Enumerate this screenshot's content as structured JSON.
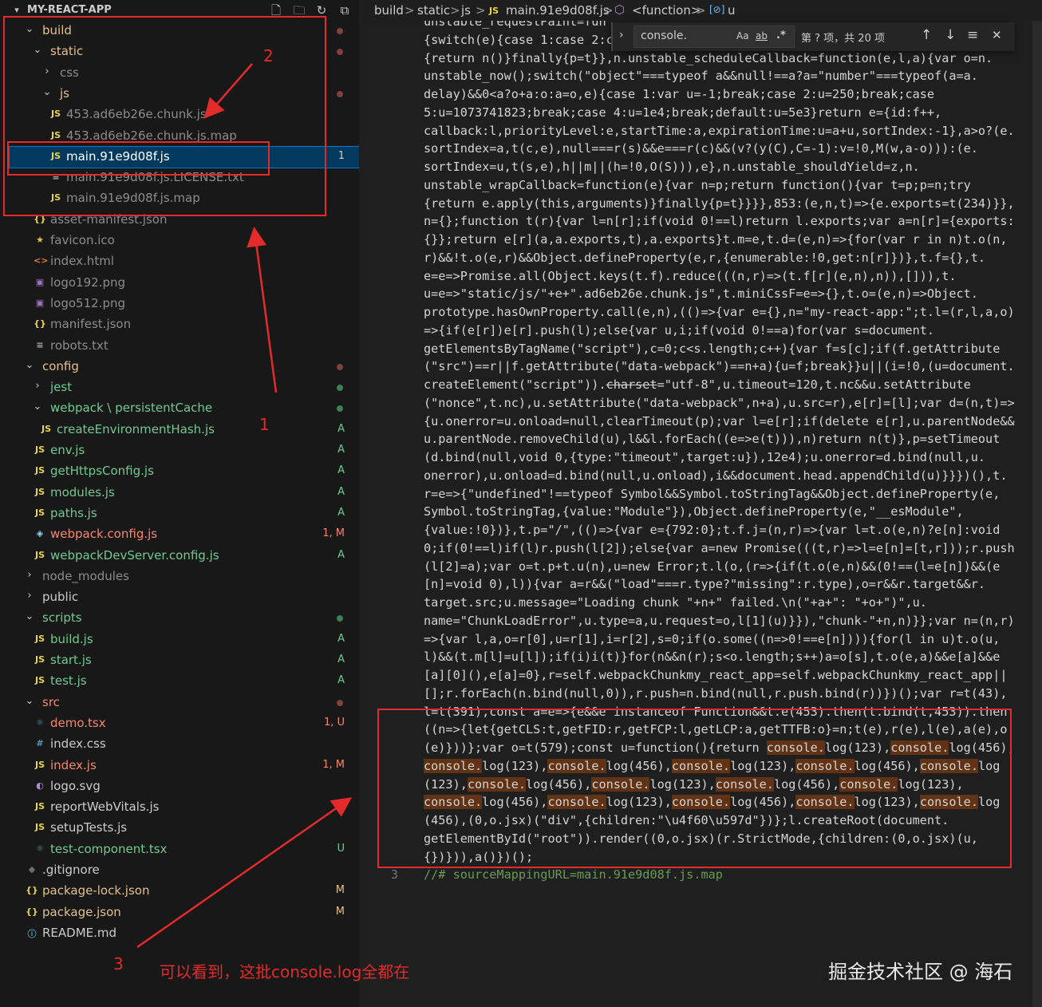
{
  "sidebar": {
    "title": "MY-REACT-APP",
    "header_icons": [
      "new-file-icon",
      "new-folder-icon",
      "refresh-icon",
      "collapse-all-icon"
    ],
    "items": [
      {
        "label": "build",
        "type": "folder",
        "expanded": true,
        "color": "#e2c08d"
      },
      {
        "label": "static",
        "type": "folder",
        "expanded": true,
        "color": "#e2c08d"
      },
      {
        "label": "css",
        "type": "folder",
        "expanded": false,
        "color": "#8c8c8c"
      },
      {
        "label": "js",
        "type": "folder",
        "expanded": true,
        "color": "#e2c08d"
      },
      {
        "label": "453.ad6eb26e.chunk.js",
        "type": "js",
        "color": "#8c8c8c"
      },
      {
        "label": "453.ad6eb26e.chunk.js.map",
        "type": "js",
        "color": "#8c8c8c"
      },
      {
        "label": "main.91e9d08f.js",
        "type": "js",
        "color": "#ffffff",
        "badge": "1",
        "selected": true
      },
      {
        "label": "main.91e9d08f.js.LICENSE.txt",
        "type": "txt",
        "color": "#8c8c8c"
      },
      {
        "label": "main.91e9d08f.js.map",
        "type": "js",
        "color": "#8c8c8c"
      },
      {
        "label": "asset-manifest.json",
        "type": "json",
        "color": "#8c8c8c"
      },
      {
        "label": "favicon.ico",
        "type": "ico",
        "color": "#8c8c8c"
      },
      {
        "label": "index.html",
        "type": "html",
        "color": "#8c8c8c"
      },
      {
        "label": "logo192.png",
        "type": "png",
        "color": "#8c8c8c"
      },
      {
        "label": "logo512.png",
        "type": "png",
        "color": "#8c8c8c"
      },
      {
        "label": "manifest.json",
        "type": "json",
        "color": "#8c8c8c"
      },
      {
        "label": "robots.txt",
        "type": "txt",
        "color": "#8c8c8c"
      },
      {
        "label": "config",
        "type": "folder",
        "expanded": true,
        "color": "#e2c08d"
      },
      {
        "label": "jest",
        "type": "folder",
        "expanded": false,
        "color": "#73c991"
      },
      {
        "label": "webpack \\ persistentCache",
        "type": "folder",
        "expanded": true,
        "color": "#73c991"
      },
      {
        "label": "createEnvironmentHash.js",
        "type": "js",
        "color": "#73c991",
        "badge": "A"
      },
      {
        "label": "env.js",
        "type": "js",
        "color": "#73c991",
        "badge": "A"
      },
      {
        "label": "getHttpsConfig.js",
        "type": "js",
        "color": "#73c991",
        "badge": "A"
      },
      {
        "label": "modules.js",
        "type": "js",
        "color": "#73c991",
        "badge": "A"
      },
      {
        "label": "paths.js",
        "type": "js",
        "color": "#73c991",
        "badge": "A"
      },
      {
        "label": "webpack.config.js",
        "type": "webpack",
        "color": "#f48771",
        "badge": "1, M"
      },
      {
        "label": "webpackDevServer.config.js",
        "type": "js",
        "color": "#73c991",
        "badge": "A"
      },
      {
        "label": "node_modules",
        "type": "folder",
        "expanded": false,
        "color": "#8c8c8c"
      },
      {
        "label": "public",
        "type": "folder",
        "expanded": false,
        "color": "#cccccc"
      },
      {
        "label": "scripts",
        "type": "folder",
        "expanded": true,
        "color": "#73c991"
      },
      {
        "label": "build.js",
        "type": "js",
        "color": "#73c991",
        "badge": "A"
      },
      {
        "label": "start.js",
        "type": "js",
        "color": "#73c991",
        "badge": "A"
      },
      {
        "label": "test.js",
        "type": "js",
        "color": "#73c991",
        "badge": "A"
      },
      {
        "label": "src",
        "type": "folder",
        "expanded": true,
        "color": "#f48771"
      },
      {
        "label": "demo.tsx",
        "type": "tsx",
        "color": "#f48771",
        "badge": "1, U"
      },
      {
        "label": "index.css",
        "type": "css",
        "color": "#cccccc"
      },
      {
        "label": "index.js",
        "type": "js",
        "color": "#f48771",
        "badge": "1, M"
      },
      {
        "label": "logo.svg",
        "type": "svg",
        "color": "#cccccc"
      },
      {
        "label": "reportWebVitals.js",
        "type": "js",
        "color": "#cccccc"
      },
      {
        "label": "setupTests.js",
        "type": "js",
        "color": "#cccccc"
      },
      {
        "label": "test-component.tsx",
        "type": "tsx",
        "color": "#73c991",
        "badge": "U"
      },
      {
        "label": ".gitignore",
        "type": "git",
        "color": "#cccccc"
      },
      {
        "label": "package-lock.json",
        "type": "json",
        "color": "#e2c08d",
        "badge": "M"
      },
      {
        "label": "package.json",
        "type": "json",
        "color": "#e2c08d",
        "badge": "M"
      },
      {
        "label": "README.md",
        "type": "info",
        "color": "#cccccc"
      }
    ]
  },
  "breadcrumb": {
    "items": [
      "build",
      "static",
      "js",
      "main.91e9d08f.js",
      "<function>",
      "u"
    ],
    "separator": ">"
  },
  "find": {
    "value": "console.",
    "match_case": "Aa",
    "whole_word": "ab",
    "regex": ".*",
    "result": "第 ? 项，共 20 项"
  },
  "editor": {
    "code_segments": [
      {
        "t": "unstable_requestPaint=fun\n{switch(e){case 1:case 2:c\n{return n()}finally{p=t}},n.unstable_scheduleCallback=function(e,l,a){var o=n.\nunstable_now();switch(\"object\"===typeof a&&null!==a?a=\"number\"===typeof(a=a.\ndelay)&&0<a?o+a:o:a=o,e){case 1:var u=-1;break;case 2:u=250;break;case\n5:u=1073741823;break;case 4:u=1e4;break;default:u=5e3}return e={id:f++,\ncallback:l,priorityLevel:e,startTime:a,expirationTime:u=a+u,sortIndex:-1},a>o?(e.\nsortIndex=a,t(c,e),null===r(s)&&e===r(c)&&(v?(y(C),C=-1):v=!0,M(w,a-o))):(e.\nsortIndex=u,t(s,e),h||m||(h=!0,O(S))),e},n.unstable_shouldYield=z,n.\nunstable_wrapCallback=function(e){var n=p;return function(){var t=p;p=n;try\n{return e.apply(this,arguments)}finally{p=t}}}},853:(e,n,t)=>{e.exports=t(234)}},\nn={};function t(r){var l=n[r];if(void 0!==l)return l.exports;var a=n[r]={exports:\n{}};return e[r](a,a.exports,t),a.exports}t.m=e,t.d=(e,n)=>{for(var r in n)t.o(n,\nr)&&!t.o(e,r)&&Object.defineProperty(e,r,{enumerable:!0,get:n[r]})},t.f={},t.\ne=e=>Promise.all(Object.keys(t.f).reduce(((n,r)=>(t.f[r](e,n),n)),[])),t.\nu=e=>\"static/js/\"+e+\".ad6eb26e.chunk.js\",t.miniCssF=e=>{},t.o=(e,n)=>Object.\nprototype.hasOwnProperty.call(e,n),(()=>{var e={},n=\"my-react-app:\";t.l=(r,l,a,o)\n=>{if(e[r])e[r].push(l);else{var u,i;if(void 0!==a)for(var s=document.\ngetElementsByTagName(\"script\"),c=0;c<s.length;c++){var f=s[c];if(f.getAttribute\n(\"src\")==r||f.getAttribute(\"data-webpack\")==n+a){u=f;break}}u||(i=!0,(u=document.\ncreateElement(\"script\")).",
        "c": ""
      },
      {
        "t": "charset",
        "c": "strike"
      },
      {
        "t": "=\"utf-8\",u.timeout=120,t.nc&&u.setAttribute\n(\"nonce\",t.nc),u.setAttribute(\"data-webpack\",n+a),u.src=r),e[r]=[l];var d=(n,t)=>\n{u.onerror=u.onload=null,clearTimeout(p);var l=e[r];if(delete e[r],u.parentNode&&\nu.parentNode.removeChild(u),l&&l.forEach((e=>e(t))),n)return n(t)},p=setTimeout\n(d.bind(null,void 0,{type:\"timeout\",target:u}),12e4);u.onerror=d.bind(null,u.\nonerror),u.onload=d.bind(null,u.onload),i&&document.head.appendChild(u)}}})(),t.\nr=e=>{\"undefined\"!==typeof Symbol&&Symbol.toStringTag&&Object.defineProperty(e,\nSymbol.toStringTag,{value:\"Module\"}),Object.defineProperty(e,\"__esModule\",\n{value:!0})},t.p=\"/\",(()=>{var e={792:0};t.f.j=(n,r)=>{var l=t.o(e,n)?e[n]:void\n0;if(0!==l)if(l)r.push(l[2]);else{var a=new Promise(((t,r)=>l=e[n]=[t,r]));r.push\n(l[2]=a);var o=t.p+t.u(n),u=new Error;t.l(o,(r=>{if(t.o(e,n)&&(0!==(l=e[n])&&(e\n[n]=void 0),l)){var a=r&&(\"load\"===r.type?\"missing\":r.type),o=r&&r.target&&r.\ntarget.src;u.message=\"Loading chunk \"+n+\" failed.\\n(\"+a+\": \"+o+\")\",u.\nname=\"ChunkLoadError\",u.type=a,u.request=o,l[1](u)}}),\"chunk-\"+n,n)}};var n=(n,r)\n=>{var l,a,o=r[0],u=r[1],i=r[2],s=0;if(o.some((n=>0!==e[n]))){for(l in u)t.o(u,\nl)&&(t.m[l]=u[l]);if(i)i(t)}for(n&&n(r);s<o.length;s++)a=o[s],t.o(e,a)&&e[a]&&e\n[a][0](),e[a]=0},r=self.webpackChunkmy_react_app=self.webpackChunkmy_react_app||\n[];r.forEach(n.bind(null,0)),r.push=n.bind(null,r.push.bind(r))})();var r=t(43),\nl=t(391),const a=e=>{e&&e instanceof Function&&t.e(453).then(t.bind(t,453)).then\n((n=>{let{getCLS:t,getFID:r,getFCP:l,getLCP:a,getTTFB:o}=n;t(e),r(e),l(e),a(e),o\n(e)}))};var o=t(579);const u=function(){return ",
        "c": ""
      },
      {
        "t": "console.",
        "c": "hl"
      },
      {
        "t": "log(123),",
        "c": ""
      },
      {
        "t": "console.",
        "c": "hl"
      },
      {
        "t": "log(456),\n",
        "c": ""
      },
      {
        "t": "console.",
        "c": "hl"
      },
      {
        "t": "log(123),",
        "c": ""
      },
      {
        "t": "console.",
        "c": "hl"
      },
      {
        "t": "log(456),",
        "c": ""
      },
      {
        "t": "console.",
        "c": "hl"
      },
      {
        "t": "log(123),",
        "c": ""
      },
      {
        "t": "console.",
        "c": "hl"
      },
      {
        "t": "log(456),",
        "c": ""
      },
      {
        "t": "console.",
        "c": "hl"
      },
      {
        "t": "log\n(123),",
        "c": ""
      },
      {
        "t": "console.",
        "c": "hl"
      },
      {
        "t": "log(456),",
        "c": ""
      },
      {
        "t": "console.",
        "c": "hl"
      },
      {
        "t": "log(123),",
        "c": ""
      },
      {
        "t": "console.",
        "c": "hl"
      },
      {
        "t": "log(456),",
        "c": ""
      },
      {
        "t": "console.",
        "c": "hl"
      },
      {
        "t": "log(123),\n",
        "c": ""
      },
      {
        "t": "console.",
        "c": "hl"
      },
      {
        "t": "log(456),",
        "c": ""
      },
      {
        "t": "console.",
        "c": "hl"
      },
      {
        "t": "log(123),",
        "c": ""
      },
      {
        "t": "console.",
        "c": "hl"
      },
      {
        "t": "log(456),",
        "c": ""
      },
      {
        "t": "console.",
        "c": "hl"
      },
      {
        "t": "log(123),",
        "c": ""
      },
      {
        "t": "console.",
        "c": "hl"
      },
      {
        "t": "log\n(456),(0,o.jsx)(\"div\",{children:\"\\u4f60\\u597d\"})};l.createRoot(document.\ngetElementById(\"root\")).render((0,o.jsx)(r.StrictMode,{children:(0,o.jsx)(u,\n{})})),a()})();",
        "c": ""
      }
    ],
    "line_number": "3",
    "map_comment": "//# sourceMappingURL=main.91e9d08f.js.map"
  },
  "annotations": {
    "numbers": [
      "2",
      "1",
      "3"
    ],
    "caption": "可以看到，这批console.log全都在",
    "color": "#e32b2b"
  },
  "watermark": "掘金技术社区 @ 海石"
}
